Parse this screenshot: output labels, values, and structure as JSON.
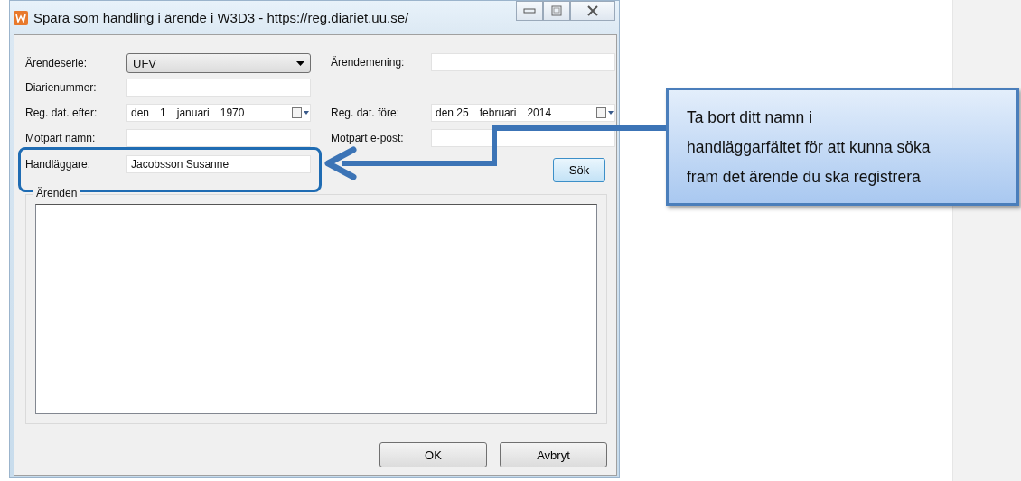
{
  "window": {
    "title": "Spara som handling i ärende i W3D3 - https://reg.diariet.uu.se/"
  },
  "rows": [
    {
      "left": {
        "kind": "dropdown",
        "label": "Ärendeserie:",
        "value": "UFV",
        "highlighted": false
      },
      "right": {
        "kind": "text",
        "label": "Ärendemening:"
      }
    },
    {
      "left": {
        "kind": "text",
        "label": "Diarienummer:",
        "highlighted": false
      }
    },
    {
      "left": {
        "kind": "date",
        "label": "Reg. dat. efter:",
        "parts": [
          "den",
          "1",
          "januari",
          "1970"
        ],
        "highlighted": false
      },
      "right": {
        "kind": "date",
        "label": "Reg. dat. före:",
        "parts": [
          "den 25",
          "februari",
          "2014"
        ]
      }
    },
    {
      "left": {
        "kind": "text",
        "label": "Motpart namn:",
        "highlighted": false
      },
      "right": {
        "kind": "text",
        "label": "Motpart e-post:"
      }
    },
    {
      "left": {
        "kind": "text",
        "label": "Handläggare:",
        "value": "Jacobsson Susanne",
        "highlighted": true
      },
      "right": {
        "kind": "button",
        "label": "Sök"
      }
    }
  ],
  "group": {
    "title": "Ärenden"
  },
  "buttons": [
    "OK",
    "Avbryt"
  ],
  "callout": {
    "lines": [
      "Ta bort ditt namn i",
      "handläggarfältet för att kunna söka",
      "fram det ärende du ska registrera"
    ]
  }
}
